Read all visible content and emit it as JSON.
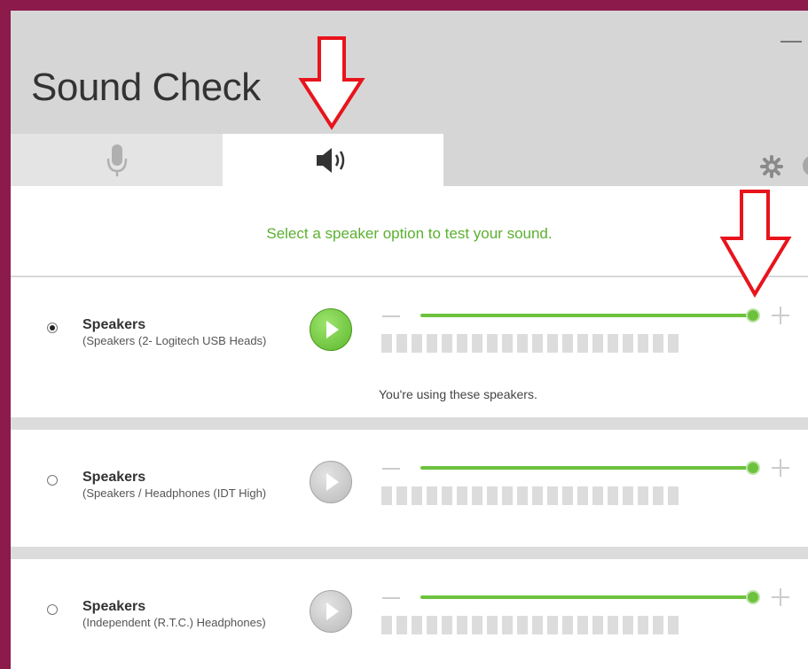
{
  "app": {
    "title": "Sound Check"
  },
  "tabs": [
    {
      "name": "microphone",
      "icon": "microphone-icon",
      "selected": false
    },
    {
      "name": "speakers",
      "icon": "speaker-icon",
      "selected": true
    }
  ],
  "prompt": "Select a speaker option to test your sound.",
  "devices": [
    {
      "name": "Speakers",
      "description": "(Speakers (2- Logitech USB Heads)",
      "selected": true,
      "volume_percent": 100,
      "status": "You're using these speakers."
    },
    {
      "name": "Speakers",
      "description": "(Speakers / Headphones (IDT High)",
      "selected": false,
      "volume_percent": 100
    },
    {
      "name": "Speakers",
      "description": "(Independent (R.T.C.) Headphones)",
      "selected": false,
      "volume_percent": 100
    }
  ],
  "colors": {
    "accent_green": "#6cc23d",
    "prompt_green": "#5bb030",
    "annotation_red": "#e8141c",
    "background": "#8c1a4a"
  }
}
